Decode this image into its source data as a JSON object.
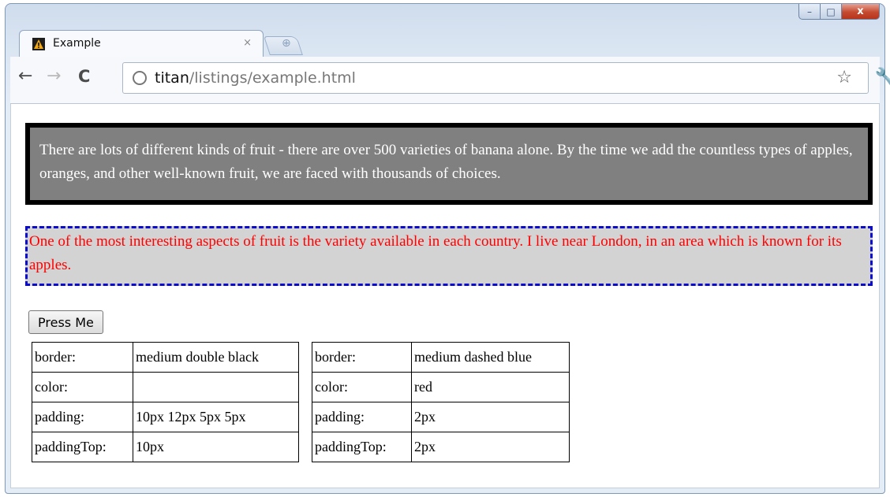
{
  "tab": {
    "title": "Example",
    "close": "×"
  },
  "window_controls": {
    "minimize": "–",
    "maximize": "□",
    "close": "x"
  },
  "toolbar": {
    "url_host": "titan",
    "url_path": "/listings/example.html"
  },
  "page": {
    "paragraph1": "There are lots of different kinds of fruit - there are over 500 varieties of banana alone. By the time we add the countless types of apples, oranges, and other well-known fruit, we are faced with thousands of choices.",
    "paragraph2": "One of the most interesting aspects of fruit is the variety available in each country. I live near London, in an area which is known for its apples.",
    "button_label": "Press Me",
    "table1": {
      "rows": [
        {
          "key": "border:",
          "value": "medium double black"
        },
        {
          "key": "color:",
          "value": ""
        },
        {
          "key": "padding:",
          "value": "10px 12px 5px 5px"
        },
        {
          "key": "paddingTop:",
          "value": "10px"
        }
      ]
    },
    "table2": {
      "rows": [
        {
          "key": "border:",
          "value": "medium dashed blue"
        },
        {
          "key": "color:",
          "value": "red"
        },
        {
          "key": "padding:",
          "value": "2px"
        },
        {
          "key": "paddingTop:",
          "value": "2px"
        }
      ]
    }
  },
  "icons": {
    "back": "back-arrow-icon",
    "forward": "forward-arrow-icon",
    "reload": "reload-icon",
    "globe": "globe-icon",
    "star": "star-icon",
    "wrench": "wrench-icon",
    "favicon": "warning-favicon-icon",
    "new_tab": "new-tab-icon"
  },
  "colors": {
    "block1_bg": "#808080",
    "block1_text": "#ffffff",
    "block1_border": "#000000",
    "block2_bg": "#d3d3d3",
    "block2_text": "#ff0000",
    "block2_border": "#0000ff"
  }
}
